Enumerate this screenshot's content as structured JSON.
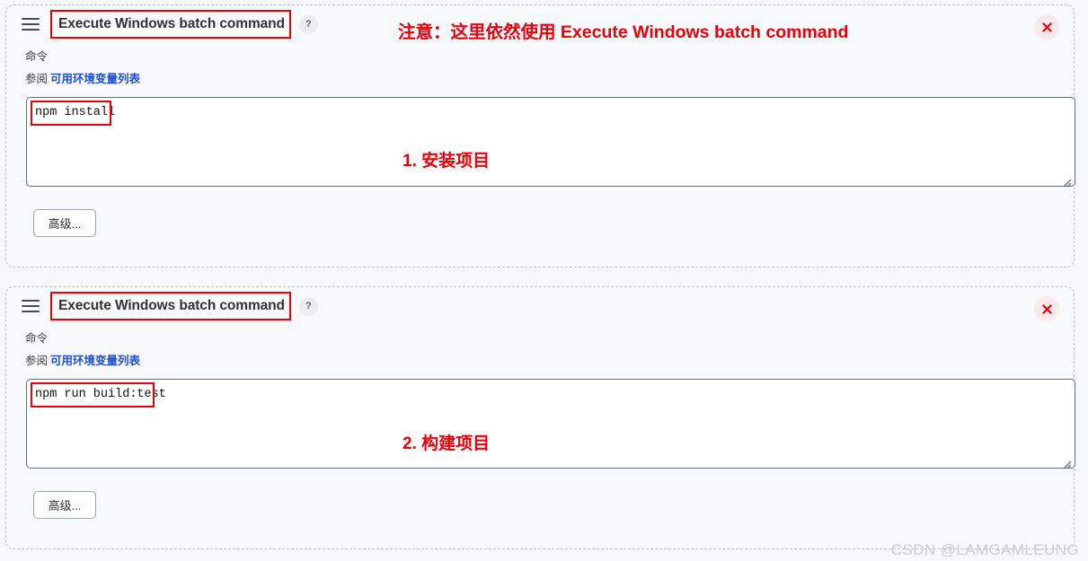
{
  "page": {
    "background": "#f7f8f9",
    "accent_red": "#e8000d",
    "link_blue": "#1b4fd8",
    "watermark": "CSDN @LAMGAMLEUNG"
  },
  "annotations": {
    "note": "注意：这里依然使用 Execute Windows batch command",
    "step_1": "1. 安装项目",
    "step_2": "2. 构建项目"
  },
  "panels": [
    {
      "id": "panel-1",
      "drag_handle_icon": "hamburger-icon",
      "title": "Execute Windows batch command",
      "help_label": "?",
      "close_label": "×",
      "field_label": "命令",
      "help_prefix": "参阅",
      "help_link": "可用环境变量列表",
      "command_value": "npm install",
      "command_placeholder": "",
      "advanced_label": "高级..."
    },
    {
      "id": "panel-2",
      "drag_handle_icon": "hamburger-icon",
      "title": "Execute Windows batch command",
      "help_label": "?",
      "close_label": "×",
      "field_label": "命令",
      "help_prefix": "参阅",
      "help_link": "可用环境变量列表",
      "command_value": "npm run build:test",
      "command_placeholder": "",
      "advanced_label": "高级..."
    }
  ]
}
